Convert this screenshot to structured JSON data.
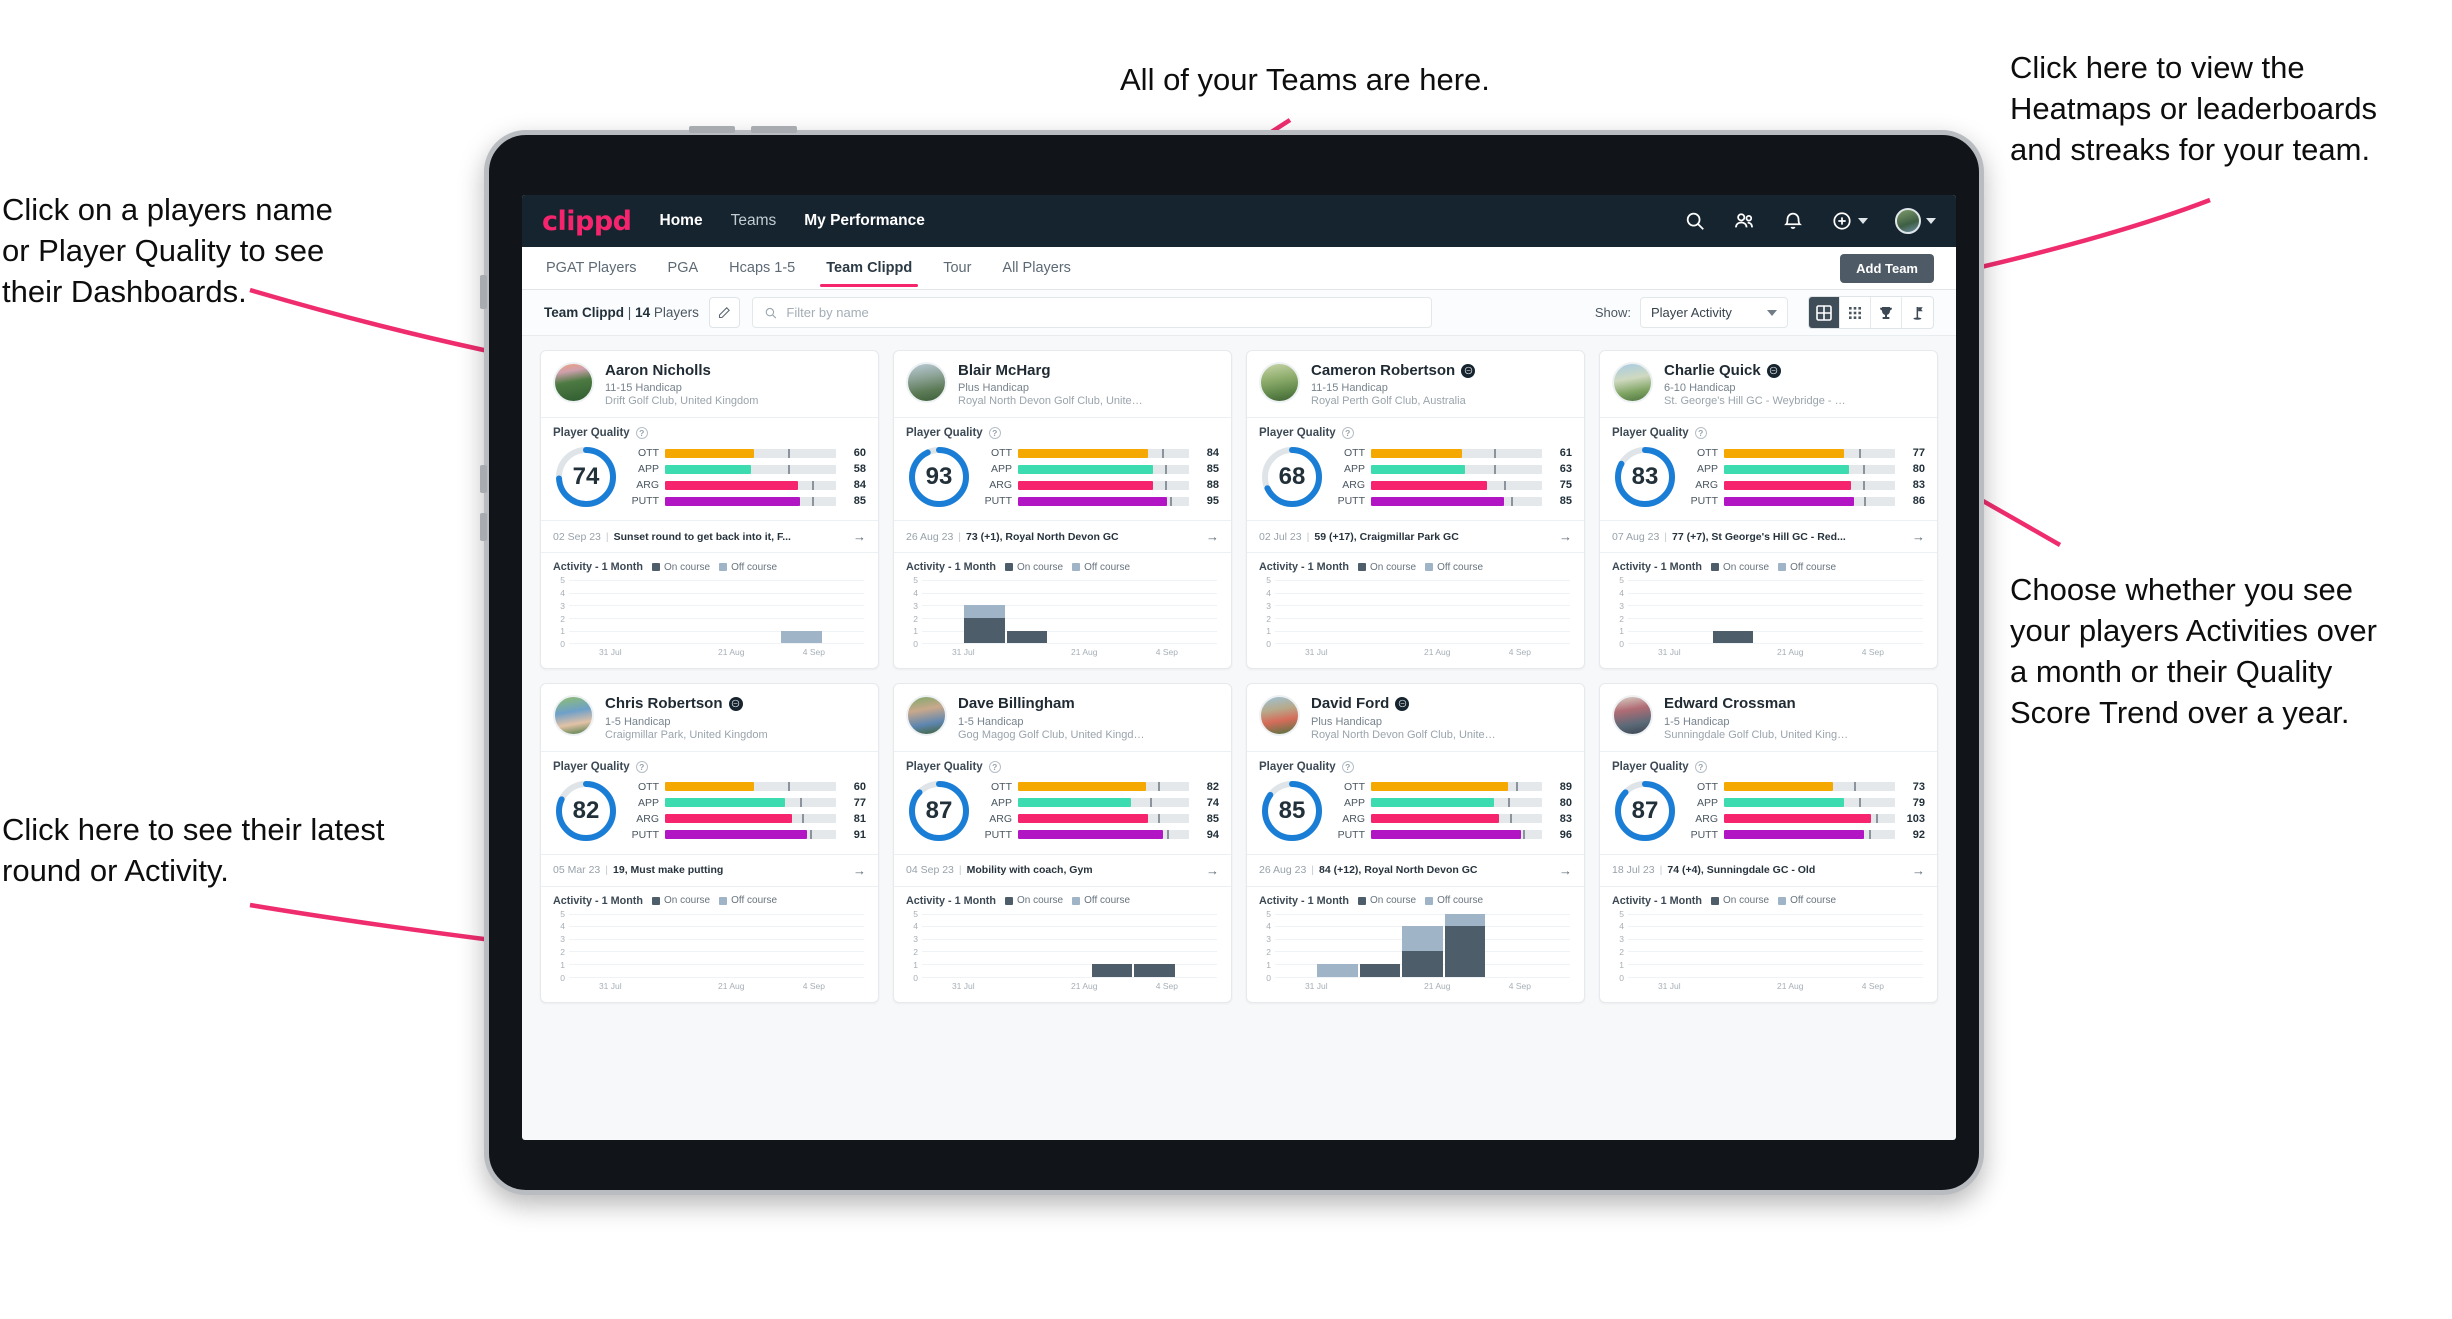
{
  "annotations": {
    "top_left": "Click on a players name\nor Player Quality to see\ntheir Dashboards.",
    "top_center": "All of your Teams are here.",
    "top_right": "Click here to view the\nHeatmaps or leaderboards\nand streaks for your team.",
    "right": "Choose whether you see\nyour players Activities over\na month or their Quality\nScore Trend over a year.",
    "bottom_left": "Click here to see their latest\nround or Activity."
  },
  "navbar": {
    "logo": "clippd",
    "links": [
      {
        "label": "Home",
        "active": true
      },
      {
        "label": "Teams",
        "active": false
      },
      {
        "label": "My Performance",
        "active": true
      }
    ],
    "icons": [
      "search-icon",
      "people-icon",
      "bell-icon",
      "plus-circle-icon",
      "avatar"
    ]
  },
  "tabs": [
    {
      "label": "PGAT Players",
      "active": false
    },
    {
      "label": "PGA",
      "active": false
    },
    {
      "label": "Hcaps 1-5",
      "active": false
    },
    {
      "label": "Team Clippd",
      "active": true
    },
    {
      "label": "Tour",
      "active": false
    },
    {
      "label": "All Players",
      "active": false
    }
  ],
  "add_team_label": "Add Team",
  "toolbar": {
    "team_name": "Team Clippd",
    "separator": "|",
    "player_count": "14",
    "players_word": "Players",
    "edit_icon": "pencil-icon",
    "search_placeholder": "Filter by name",
    "search_value": "",
    "show_label": "Show:",
    "show_value": "Player Activity",
    "view_buttons": [
      {
        "name": "grid-large-icon",
        "active": true
      },
      {
        "name": "grid-small-icon",
        "active": false
      },
      {
        "name": "trophy-icon",
        "active": false
      },
      {
        "name": "flag-icon",
        "active": false
      }
    ]
  },
  "labels": {
    "player_quality": "Player Quality",
    "activity_title": "Activity - 1 Month",
    "legend_on": "On course",
    "legend_off": "Off course",
    "arrow": "→"
  },
  "colors": {
    "brand_pink": "#f5246c",
    "navy": "#16242f",
    "ring_blue": "#1b7ed6",
    "ott": "#f5a800",
    "app": "#3ddbb0",
    "arg": "#f5246c",
    "putt": "#b215c4",
    "on_course": "#4e5d6a",
    "off_course": "#9fb4c6"
  },
  "chart_data": {
    "type": "bar",
    "title": "Activity - 1 Month",
    "ylabel": "",
    "xlabel": "",
    "ylim": [
      0,
      5
    ],
    "yticks": [
      0,
      1,
      2,
      3,
      4,
      5
    ],
    "grid": true,
    "legend": [
      "On course",
      "Off course"
    ],
    "xtick_labels": [
      "31 Jul",
      "21 Aug",
      "4 Sep"
    ],
    "stacked": true
  },
  "players": [
    {
      "name": "Aaron Nicholls",
      "verified": false,
      "handicap": "11-15 Handicap",
      "club": "Drift Golf Club, United Kingdom",
      "avatar_css": "linear-gradient(170deg,#f0a17a 0%,#cfa0ad 22%,#4d7a42 48%,#2f5c30 100%)",
      "quality": 74,
      "metrics": [
        {
          "label": "OTT",
          "value": 60,
          "pct": 52,
          "tick": 72,
          "color": "#f5a800"
        },
        {
          "label": "APP",
          "value": 58,
          "pct": 50,
          "tick": 72,
          "color": "#3ddbb0"
        },
        {
          "label": "ARG",
          "value": 84,
          "pct": 78,
          "tick": 86,
          "color": "#f5246c"
        },
        {
          "label": "PUTT",
          "value": 85,
          "pct": 79,
          "tick": 86,
          "color": "#b215c4"
        }
      ],
      "latest_date": "02 Sep 23",
      "latest_text": "Sunset round to get back into it, F...",
      "activity": {
        "on": [
          0,
          0,
          0,
          0,
          0,
          0,
          0
        ],
        "off": [
          0,
          0,
          0,
          0,
          0,
          1,
          0
        ]
      }
    },
    {
      "name": "Blair McHarg",
      "verified": false,
      "handicap": "Plus Handicap",
      "club": "Royal North Devon Golf Club, United Kin...",
      "avatar_css": "linear-gradient(170deg,#b9cbd6 0%,#8fa59a 35%,#5c7a56 70%,#3e5f3a 100%)",
      "quality": 93,
      "metrics": [
        {
          "label": "OTT",
          "value": 84,
          "pct": 76,
          "tick": 84,
          "color": "#f5a800"
        },
        {
          "label": "APP",
          "value": 85,
          "pct": 79,
          "tick": 86,
          "color": "#3ddbb0"
        },
        {
          "label": "ARG",
          "value": 88,
          "pct": 79,
          "tick": 86,
          "color": "#f5246c"
        },
        {
          "label": "PUTT",
          "value": 95,
          "pct": 87,
          "tick": 89,
          "color": "#b215c4"
        }
      ],
      "latest_date": "26 Aug 23",
      "latest_text": "73 (+1), Royal North Devon GC",
      "activity": {
        "on": [
          0,
          2,
          1,
          0,
          0,
          0,
          0
        ],
        "off": [
          0,
          1,
          0,
          0,
          0,
          0,
          0
        ],
        "special": [
          [
            1,
            2,
            1
          ],
          [
            2,
            1,
            0
          ],
          [
            4,
            4,
            0
          ]
        ]
      }
    },
    {
      "name": "Cameron Robertson",
      "verified": true,
      "handicap": "11-15 Handicap",
      "club": "Royal Perth Golf Club, Australia",
      "avatar_css": "linear-gradient(170deg,#c8d4a8 0%,#8fae6e 40%,#5e8548 75%,#3f6236 100%)",
      "quality": 68,
      "metrics": [
        {
          "label": "OTT",
          "value": 61,
          "pct": 53,
          "tick": 72,
          "color": "#f5a800"
        },
        {
          "label": "APP",
          "value": 63,
          "pct": 55,
          "tick": 72,
          "color": "#3ddbb0"
        },
        {
          "label": "ARG",
          "value": 75,
          "pct": 68,
          "tick": 78,
          "color": "#f5246c"
        },
        {
          "label": "PUTT",
          "value": 85,
          "pct": 78,
          "tick": 82,
          "color": "#b215c4"
        }
      ],
      "latest_date": "02 Jul 23",
      "latest_text": "59 (+17), Craigmillar Park GC",
      "activity": {
        "on": [
          0,
          0,
          0,
          0,
          0,
          0,
          0
        ],
        "off": [
          0,
          0,
          0,
          0,
          0,
          0,
          0
        ]
      }
    },
    {
      "name": "Charlie Quick",
      "verified": true,
      "handicap": "6-10 Handicap",
      "club": "St. George's Hill GC - Weybridge - Surrey, ...",
      "avatar_css": "linear-gradient(170deg,#a7cbe4 0%,#cfd9c0 40%,#7fa463 72%,#4e7442 100%)",
      "quality": 83,
      "metrics": [
        {
          "label": "OTT",
          "value": 77,
          "pct": 70,
          "tick": 79,
          "color": "#f5a800"
        },
        {
          "label": "APP",
          "value": 80,
          "pct": 73,
          "tick": 81,
          "color": "#3ddbb0"
        },
        {
          "label": "ARG",
          "value": 83,
          "pct": 74,
          "tick": 81,
          "color": "#f5246c"
        },
        {
          "label": "PUTT",
          "value": 86,
          "pct": 76,
          "tick": 82,
          "color": "#b215c4"
        }
      ],
      "latest_date": "07 Aug 23",
      "latest_text": "77 (+7), St George's Hill GC - Red...",
      "activity": {
        "on": [
          0,
          0,
          1,
          0,
          0,
          0,
          0
        ],
        "off": [
          0,
          0,
          0,
          0,
          0,
          0,
          0
        ]
      }
    },
    {
      "name": "Chris Robertson",
      "verified": true,
      "handicap": "1-5 Handicap",
      "club": "Craigmillar Park, United Kingdom",
      "avatar_css": "linear-gradient(170deg,#8fbf6e 0%,#6ea0c9 40%,#e2c2a6 70%,#4a7a46 100%)",
      "quality": 82,
      "metrics": [
        {
          "label": "OTT",
          "value": 60,
          "pct": 52,
          "tick": 72,
          "color": "#f5a800"
        },
        {
          "label": "APP",
          "value": 77,
          "pct": 70,
          "tick": 79,
          "color": "#3ddbb0"
        },
        {
          "label": "ARG",
          "value": 81,
          "pct": 74,
          "tick": 80,
          "color": "#f5246c"
        },
        {
          "label": "PUTT",
          "value": 91,
          "pct": 83,
          "tick": 85,
          "color": "#b215c4"
        }
      ],
      "latest_date": "05 Mar 23",
      "latest_text": "19, Must make putting",
      "activity": {
        "on": [
          0,
          0,
          0,
          0,
          0,
          0,
          0
        ],
        "off": [
          0,
          0,
          0,
          0,
          0,
          0,
          0
        ]
      }
    },
    {
      "name": "Dave Billingham",
      "verified": false,
      "handicap": "1-5 Handicap",
      "club": "Gog Magog Golf Club, United Kingdom",
      "avatar_css": "linear-gradient(170deg,#7fa96a 0%,#c9a88c 35%,#5e86b0 70%,#3f6236 100%)",
      "quality": 87,
      "metrics": [
        {
          "label": "OTT",
          "value": 82,
          "pct": 75,
          "tick": 82,
          "color": "#f5a800"
        },
        {
          "label": "APP",
          "value": 74,
          "pct": 66,
          "tick": 77,
          "color": "#3ddbb0"
        },
        {
          "label": "ARG",
          "value": 85,
          "pct": 76,
          "tick": 82,
          "color": "#f5246c"
        },
        {
          "label": "PUTT",
          "value": 94,
          "pct": 85,
          "tick": 87,
          "color": "#b215c4"
        }
      ],
      "latest_date": "04 Sep 23",
      "latest_text": "Mobility with coach, Gym",
      "activity": {
        "on": [
          0,
          0,
          0,
          0,
          1,
          1,
          0
        ],
        "off": [
          0,
          0,
          0,
          0,
          0,
          0,
          0
        ]
      }
    },
    {
      "name": "David Ford",
      "verified": true,
      "handicap": "Plus Handicap",
      "club": "Royal North Devon Golf Club, United Kin...",
      "avatar_css": "linear-gradient(170deg,#9ec3d6 0%,#b7a98a 35%,#d66c5a 62%,#4e7442 100%)",
      "quality": 85,
      "metrics": [
        {
          "label": "OTT",
          "value": 89,
          "pct": 80,
          "tick": 85,
          "color": "#f5a800"
        },
        {
          "label": "APP",
          "value": 80,
          "pct": 72,
          "tick": 80,
          "color": "#3ddbb0"
        },
        {
          "label": "ARG",
          "value": 83,
          "pct": 75,
          "tick": 81,
          "color": "#f5246c"
        },
        {
          "label": "PUTT",
          "value": 96,
          "pct": 88,
          "tick": 89,
          "color": "#b215c4"
        }
      ],
      "latest_date": "26 Aug 23",
      "latest_text": "84 (+12), Royal North Devon GC",
      "activity": {
        "on": [
          0,
          0,
          1,
          2,
          4,
          0,
          0
        ],
        "off": [
          0,
          1,
          0,
          2,
          1,
          0,
          0
        ]
      }
    },
    {
      "name": "Edward Crossman",
      "verified": false,
      "handicap": "1-5 Handicap",
      "club": "Sunningdale Golf Club, United Kingdom",
      "avatar_css": "linear-gradient(170deg,#d8d2c6 0%,#b06c74 35%,#5c6a78 70%,#3a4450 100%)",
      "quality": 87,
      "metrics": [
        {
          "label": "OTT",
          "value": 73,
          "pct": 64,
          "tick": 76,
          "color": "#f5a800"
        },
        {
          "label": "APP",
          "value": 79,
          "pct": 70,
          "tick": 79,
          "color": "#3ddbb0"
        },
        {
          "label": "ARG",
          "value": 103,
          "pct": 86,
          "tick": 89,
          "color": "#f5246c"
        },
        {
          "label": "PUTT",
          "value": 92,
          "pct": 82,
          "tick": 85,
          "color": "#b215c4"
        }
      ],
      "latest_date": "18 Jul 23",
      "latest_text": "74 (+4), Sunningdale GC - Old",
      "activity": {
        "on": [
          0,
          0,
          0,
          0,
          0,
          0,
          0
        ],
        "off": [
          0,
          0,
          0,
          0,
          0,
          0,
          0
        ]
      }
    }
  ]
}
